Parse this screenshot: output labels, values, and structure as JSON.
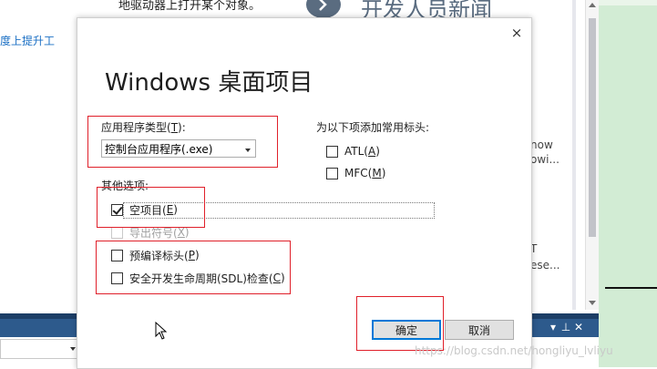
{
  "background": {
    "top_text": "地驱动器上打开某个对象。",
    "left_link": "度上提升工",
    "news_heading": "开发人员新闻",
    "fragments": [
      "now",
      "owi...",
      "T",
      "ese..."
    ]
  },
  "dialog": {
    "title": "Windows 桌面项目",
    "close_label": "×",
    "app_type": {
      "label": "应用程序类型(",
      "accel": "T",
      "label_end": "):",
      "selected": "控制台应用程序(.exe)"
    },
    "headers_label": "为以下项添加常用标头:",
    "headers": [
      {
        "text": "ATL(",
        "accel": "A",
        "end": ")",
        "checked": false
      },
      {
        "text": "MFC(",
        "accel": "M",
        "end": ")",
        "checked": false
      }
    ],
    "other_label": "其他选项:",
    "options": [
      {
        "text": "空项目(",
        "accel": "E",
        "end": ")",
        "checked": true,
        "enabled": true
      },
      {
        "text": "导出符号(",
        "accel": "X",
        "end": ")",
        "checked": false,
        "enabled": false
      },
      {
        "text": "预编译标头(",
        "accel": "P",
        "end": ")",
        "checked": false,
        "enabled": true
      },
      {
        "text": "安全开发生命周期(SDL)检查(",
        "accel": "C",
        "end": ")",
        "checked": false,
        "enabled": true
      }
    ],
    "ok_label": "确定",
    "cancel_label": "取消"
  },
  "watermark": "https://blog.csdn.net/hongliyu_lvliyu",
  "colors": {
    "accent": "#0078d7",
    "highlight_red": "#e0202a",
    "news": "#5a6c80"
  }
}
